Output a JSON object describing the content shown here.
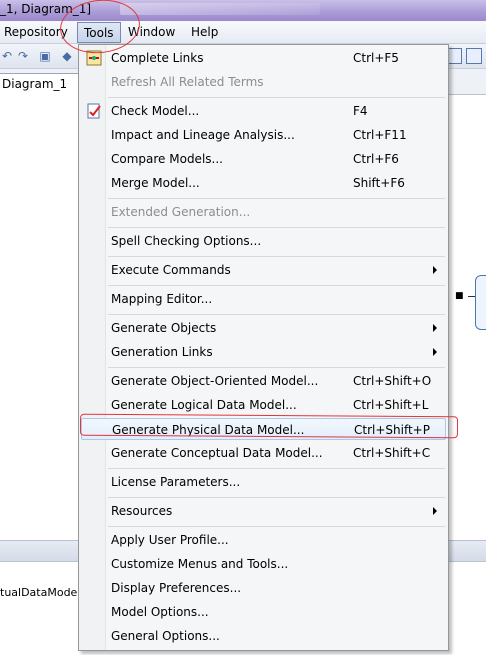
{
  "window": {
    "title": "_1, Diagram_1]"
  },
  "menubar": {
    "items": [
      {
        "label": "Repository",
        "active": false
      },
      {
        "label": "Tools",
        "active": true
      },
      {
        "label": "Window",
        "active": false
      },
      {
        "label": "Help",
        "active": false
      }
    ]
  },
  "tabs": [
    {
      "label": "Diagram_1"
    }
  ],
  "bottom_panel": {
    "item": "tualDataModel_"
  },
  "tools_menu": {
    "items": [
      {
        "label": "Complete Links",
        "shortcut": "Ctrl+F5",
        "icon": "complete-links-icon",
        "disabled": false
      },
      {
        "label": "Refresh All Related Terms",
        "shortcut": "",
        "disabled": true
      },
      {
        "label": "Check Model...",
        "shortcut": "F4",
        "icon": "check-model-icon",
        "disabled": false
      },
      {
        "label": "Impact and Lineage Analysis...",
        "shortcut": "Ctrl+F11",
        "disabled": false
      },
      {
        "label": "Compare Models...",
        "shortcut": "Ctrl+F6",
        "disabled": false
      },
      {
        "label": "Merge Model...",
        "shortcut": "Shift+F6",
        "disabled": false
      },
      {
        "label": "Extended Generation...",
        "shortcut": "",
        "disabled": true
      },
      {
        "label": "Spell Checking Options...",
        "shortcut": "",
        "disabled": false
      },
      {
        "label": "Execute Commands",
        "shortcut": "",
        "submenu": true
      },
      {
        "label": "Mapping Editor...",
        "shortcut": ""
      },
      {
        "label": "Generate Objects",
        "shortcut": "",
        "submenu": true
      },
      {
        "label": "Generation Links",
        "shortcut": "",
        "submenu": true
      },
      {
        "label": "Generate Object-Oriented Model...",
        "shortcut": "Ctrl+Shift+O"
      },
      {
        "label": "Generate Logical Data Model...",
        "shortcut": "Ctrl+Shift+L"
      },
      {
        "label": "Generate Physical Data Model...",
        "shortcut": "Ctrl+Shift+P",
        "highlighted": true
      },
      {
        "label": "Generate Conceptual Data Model...",
        "shortcut": "Ctrl+Shift+C"
      },
      {
        "label": "License Parameters...",
        "shortcut": ""
      },
      {
        "label": "Resources",
        "shortcut": "",
        "submenu": true
      },
      {
        "label": "Apply User Profile...",
        "shortcut": ""
      },
      {
        "label": "Customize Menus and Tools...",
        "shortcut": ""
      },
      {
        "label": "Display Preferences...",
        "shortcut": ""
      },
      {
        "label": "Model Options...",
        "shortcut": ""
      },
      {
        "label": "General Options...",
        "shortcut": ""
      }
    ]
  },
  "annotation_color": "#e2343a"
}
